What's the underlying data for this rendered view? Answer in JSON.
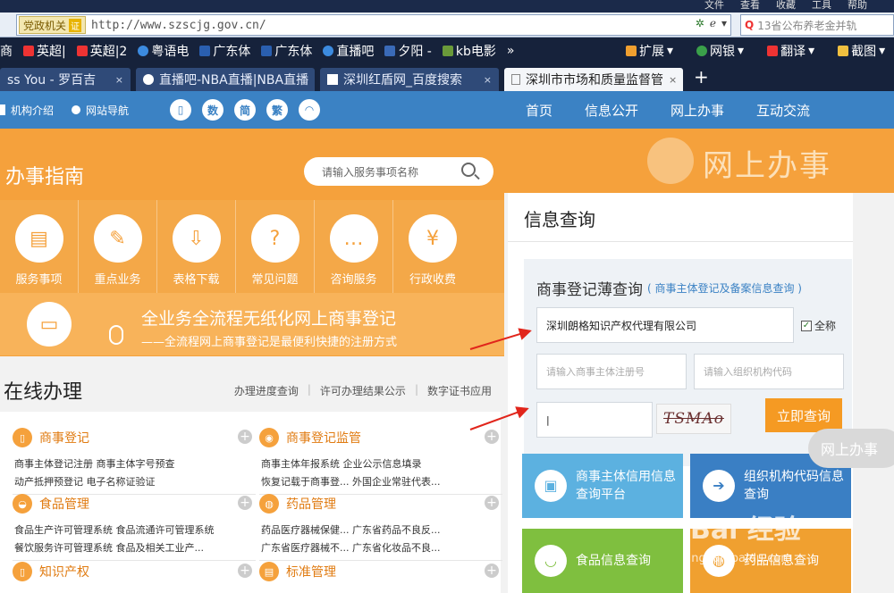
{
  "browser": {
    "menubar": [
      "文件",
      "查看",
      "收藏",
      "工具",
      "帮助"
    ],
    "address": {
      "badge": "党政机关",
      "badge_icon": "证",
      "url": "http://www.szscjg.gov.cn/"
    },
    "search": {
      "text": "13省公布养老金并轨"
    },
    "bookmarks": [
      "商",
      "英超|",
      "英超|2",
      "粤语电",
      "广东体",
      "广东体",
      "直播吧",
      "夕阳 -",
      "kb电影",
      "»"
    ],
    "bookmarks_right": [
      "扩展",
      "网银",
      "翻译",
      "截图"
    ],
    "tabs": [
      {
        "label": "ss You - 罗百吉",
        "active": false
      },
      {
        "label": "直播吧-NBA直播|NBA直播",
        "active": false
      },
      {
        "label": "深圳红盾网_百度搜索",
        "active": false
      },
      {
        "label": "深圳市市场和质量监督管",
        "active": true
      }
    ],
    "new_tab": "+"
  },
  "sitenav": {
    "left_links": [
      "机构介绍",
      "网站导航"
    ],
    "round_buttons": [
      "数",
      "简",
      "繁"
    ],
    "main": [
      "首页",
      "信息公开",
      "网上办事",
      "互动交流"
    ]
  },
  "guide": {
    "title": "办事指南",
    "search_placeholder": "请输入服务事项名称",
    "items": [
      "服务事项",
      "重点业务",
      "表格下载",
      "常见问题",
      "咨询服务",
      "行政收费"
    ],
    "banner_title": "全业务全流程无纸化网上商事登记",
    "banner_sub": "——全流程网上商事登记是最便利快捷的注册方式"
  },
  "online": {
    "title": "在线办理",
    "links": [
      "办理进度查询",
      "许可办理结果公示",
      "数字证书应用"
    ],
    "categories": [
      {
        "name": "商事登记",
        "lines": [
          "商事主体登记注册  商事主体字号预查",
          "动产抵押预登记  电子名称证验证"
        ]
      },
      {
        "name": "商事登记监管",
        "lines": [
          "商事主体年报系统  企业公示信息填录",
          "恢复记载于商事登...  外国企业常驻代表..."
        ]
      },
      {
        "name": "食品管理",
        "lines": [
          "食品生产许可管理系统  食品流通许可管理系统",
          "餐饮服务许可管理系统  食品及相关工业产..."
        ]
      },
      {
        "name": "药品管理",
        "lines": [
          "药品医疗器械保健...  广东省药品不良反...",
          "广东省医疗器械不...  广东省化妆品不良..."
        ]
      },
      {
        "name": "知识产权",
        "lines": []
      },
      {
        "name": "标准管理",
        "lines": []
      }
    ]
  },
  "right": {
    "banner": "网上办事",
    "info_title": "信息查询",
    "reg_title": "商事登记薄查询",
    "reg_sub": "( 商事主体登记及备案信息查询 )",
    "name_value": "深圳朗格知识产权代理有限公司",
    "full_name_label": "全称",
    "regno_placeholder": "请输入商事主体注册号",
    "orgcode_placeholder": "请输入组织机构代码",
    "captcha_value": "|",
    "captcha_text": "TSMAo",
    "query_button": "立即查询",
    "tiles": [
      {
        "label": "商事主体信用信息查询平台",
        "color": "#5cb1e0"
      },
      {
        "label": "组织机构代码信息查询",
        "color": "#3a7fc4"
      },
      {
        "label": "食品信息查询",
        "color": "#7fbf3f"
      },
      {
        "label": "药品信息查询",
        "color": "#f0a030"
      }
    ],
    "float_button": "网上办事"
  },
  "watermark": {
    "main": "Bai 经验",
    "sub": "jingyan.baidu.com"
  },
  "colors": {
    "orange": "#f5a13c",
    "blue": "#3b82c4",
    "arrow": "#e1251b"
  }
}
